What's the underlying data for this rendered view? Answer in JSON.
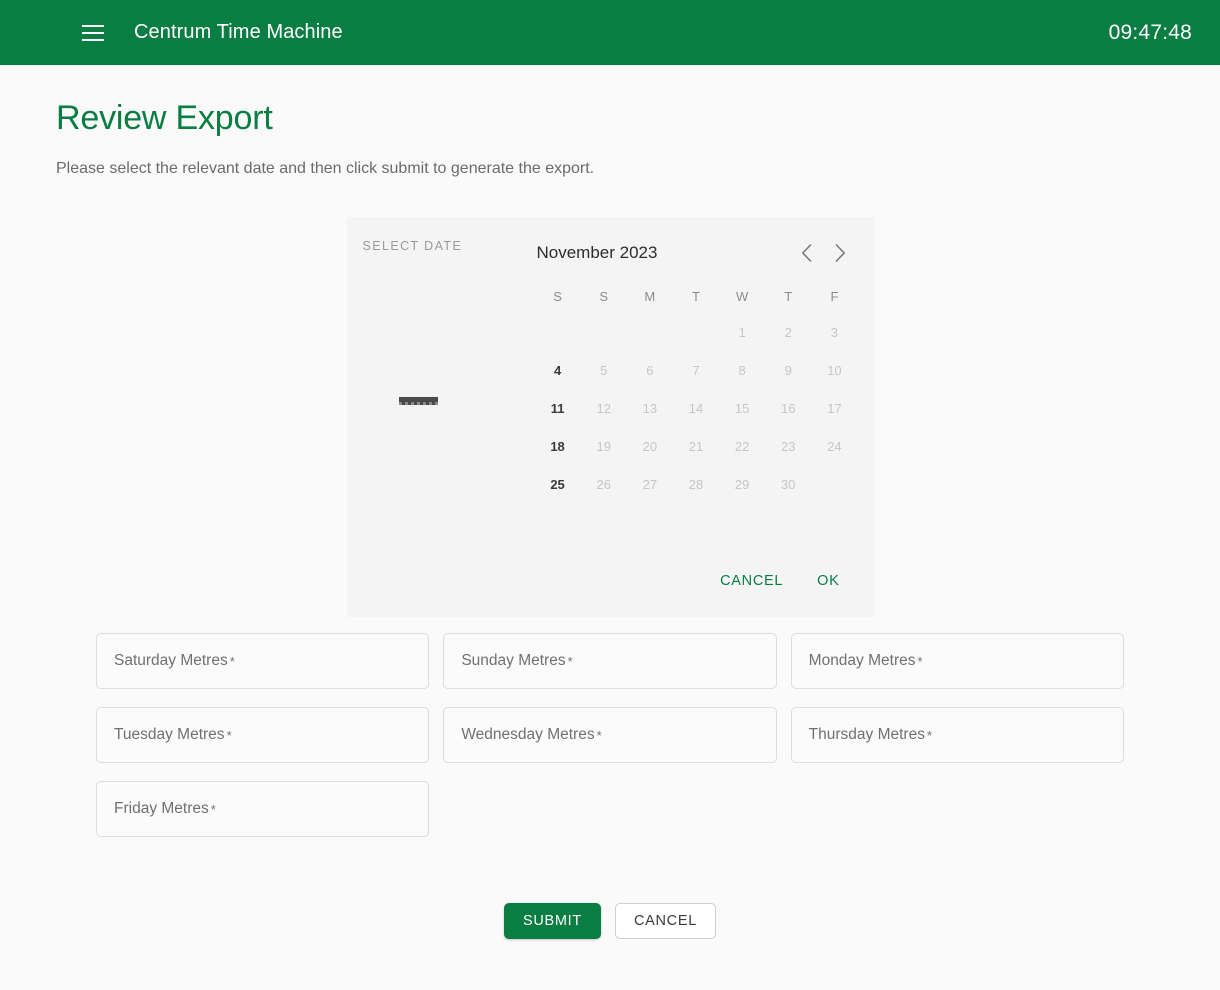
{
  "appbar": {
    "menu_icon": "hamburger-menu-icon",
    "title": "Centrum Time Machine",
    "clock": "09:47:48",
    "background_color": "#0a7d42"
  },
  "page": {
    "title": "Review Export",
    "subtitle": "Please select the relevant date and then click submit to generate the export.",
    "title_color": "#0a7d42",
    "background_color": "#fafafa"
  },
  "datepicker": {
    "side_label": "SELECT DATE",
    "selected_value": "",
    "month_label": "November 2023",
    "prev_icon": "chevron-left-icon",
    "next_icon": "chevron-right-icon",
    "weekdays": [
      "S",
      "S",
      "M",
      "T",
      "W",
      "T",
      "F"
    ],
    "weeks": [
      [
        {
          "day": "",
          "enabled": false,
          "empty": true
        },
        {
          "day": "",
          "enabled": false,
          "empty": true
        },
        {
          "day": "",
          "enabled": false,
          "empty": true
        },
        {
          "day": "",
          "enabled": false,
          "empty": true
        },
        {
          "day": "1",
          "enabled": false,
          "empty": false
        },
        {
          "day": "2",
          "enabled": false,
          "empty": false
        },
        {
          "day": "3",
          "enabled": false,
          "empty": false
        }
      ],
      [
        {
          "day": "4",
          "enabled": true,
          "empty": false
        },
        {
          "day": "5",
          "enabled": false,
          "empty": false
        },
        {
          "day": "6",
          "enabled": false,
          "empty": false
        },
        {
          "day": "7",
          "enabled": false,
          "empty": false
        },
        {
          "day": "8",
          "enabled": false,
          "empty": false
        },
        {
          "day": "9",
          "enabled": false,
          "empty": false
        },
        {
          "day": "10",
          "enabled": false,
          "empty": false
        }
      ],
      [
        {
          "day": "11",
          "enabled": true,
          "empty": false
        },
        {
          "day": "12",
          "enabled": false,
          "empty": false
        },
        {
          "day": "13",
          "enabled": false,
          "empty": false
        },
        {
          "day": "14",
          "enabled": false,
          "empty": false
        },
        {
          "day": "15",
          "enabled": false,
          "empty": false
        },
        {
          "day": "16",
          "enabled": false,
          "empty": false
        },
        {
          "day": "17",
          "enabled": false,
          "empty": false
        }
      ],
      [
        {
          "day": "18",
          "enabled": true,
          "empty": false
        },
        {
          "day": "19",
          "enabled": false,
          "empty": false
        },
        {
          "day": "20",
          "enabled": false,
          "empty": false
        },
        {
          "day": "21",
          "enabled": false,
          "empty": false
        },
        {
          "day": "22",
          "enabled": false,
          "empty": false
        },
        {
          "day": "23",
          "enabled": false,
          "empty": false
        },
        {
          "day": "24",
          "enabled": false,
          "empty": false
        }
      ],
      [
        {
          "day": "25",
          "enabled": true,
          "empty": false
        },
        {
          "day": "26",
          "enabled": false,
          "empty": false
        },
        {
          "day": "27",
          "enabled": false,
          "empty": false
        },
        {
          "day": "28",
          "enabled": false,
          "empty": false
        },
        {
          "day": "29",
          "enabled": false,
          "empty": false
        },
        {
          "day": "30",
          "enabled": false,
          "empty": false
        },
        {
          "day": "",
          "enabled": false,
          "empty": true
        }
      ]
    ],
    "cancel_label": "CANCEL",
    "ok_label": "OK",
    "action_color": "#0a7d42"
  },
  "form": {
    "fields": [
      {
        "label": "Saturday Metres",
        "required": "*",
        "value": "",
        "name": "saturday-metres"
      },
      {
        "label": "Sunday Metres",
        "required": "*",
        "value": "",
        "name": "sunday-metres"
      },
      {
        "label": "Monday Metres",
        "required": "*",
        "value": "",
        "name": "monday-metres"
      },
      {
        "label": "Tuesday Metres",
        "required": "*",
        "value": "",
        "name": "tuesday-metres"
      },
      {
        "label": "Wednesday Metres",
        "required": "*",
        "value": "",
        "name": "wednesday-metres"
      },
      {
        "label": "Thursday Metres",
        "required": "*",
        "value": "",
        "name": "thursday-metres"
      },
      {
        "label": "Friday Metres",
        "required": "*",
        "value": "",
        "name": "friday-metres"
      }
    ]
  },
  "footer": {
    "submit_label": "SUBMIT",
    "cancel_label": "CANCEL"
  }
}
